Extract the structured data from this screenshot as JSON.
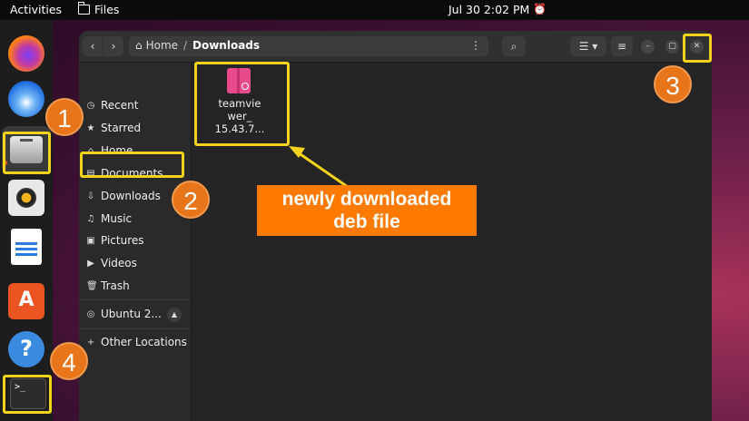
{
  "topbar": {
    "activities": "Activities",
    "app_name": "Files",
    "clock": "Jul 30  2:02 PM"
  },
  "dock": {
    "apps": [
      "firefox",
      "thunderbird",
      "files",
      "rhythmbox",
      "libreoffice-writer",
      "ubuntu-software",
      "help",
      "terminal"
    ],
    "terminal_glyph": ">_"
  },
  "window": {
    "path": {
      "home": "Home",
      "separator": "/",
      "current": "Downloads"
    },
    "sidebar": {
      "items": [
        {
          "label": "Recent",
          "icon": "clock-icon"
        },
        {
          "label": "Starred",
          "icon": "star-icon"
        },
        {
          "label": "Home",
          "icon": "home-icon"
        },
        {
          "label": "Documents",
          "icon": "document-icon"
        },
        {
          "label": "Downloads",
          "icon": "download-icon"
        },
        {
          "label": "Music",
          "icon": "music-icon"
        },
        {
          "label": "Pictures",
          "icon": "picture-icon"
        },
        {
          "label": "Videos",
          "icon": "video-icon"
        },
        {
          "label": "Trash",
          "icon": "trash-icon"
        }
      ],
      "drive": "Ubuntu 2...",
      "other": "Other Locations"
    },
    "files": [
      {
        "name_line1": "teamvie",
        "name_line2": "wer_",
        "name_line3": "15.43.7...",
        "type": "deb-package"
      }
    ]
  },
  "annotations": {
    "steps": [
      "1",
      "2",
      "3",
      "4"
    ],
    "callout_line1": "newly downloaded",
    "callout_line2": "deb file",
    "highlight_color": "#f5d21c",
    "badge_color": "#e8751a",
    "callout_color": "#ff7a00"
  }
}
